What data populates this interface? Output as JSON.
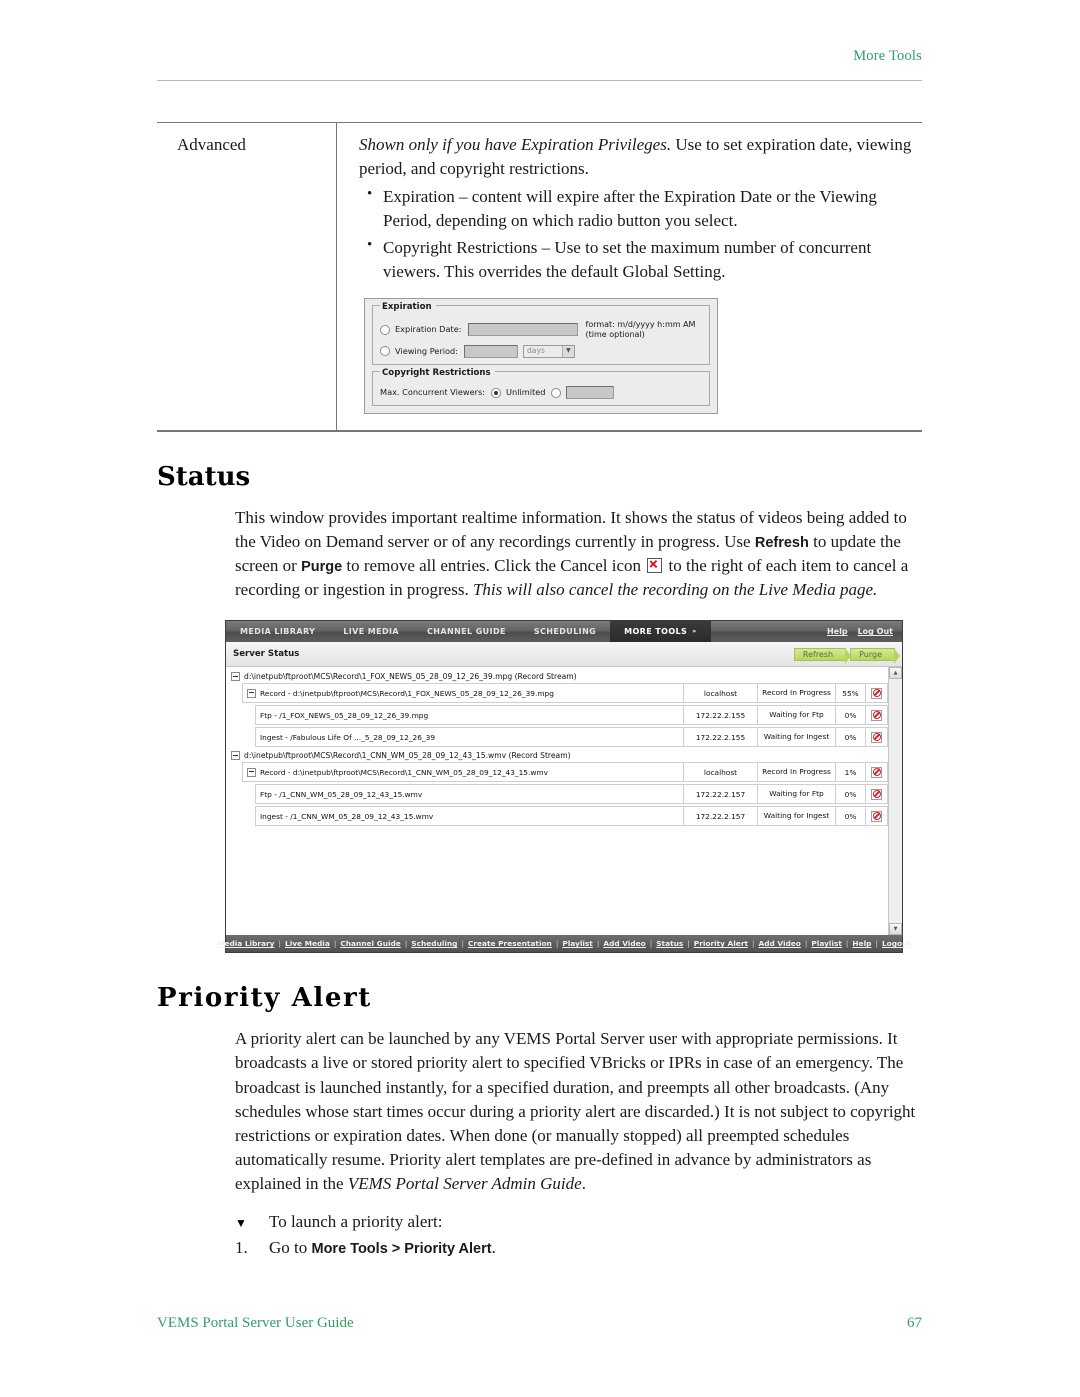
{
  "header": {
    "running_head": "More Tools"
  },
  "footer": {
    "guide_title": "VEMS Portal Server User Guide",
    "page_number": "67"
  },
  "definition_table": {
    "term": "Advanced",
    "intro_italic": "Shown only if you have Expiration Privileges.",
    "intro_rest": " Use to set expiration date, viewing period, and copyright restrictions.",
    "bullets": [
      "Expiration – content will expire after the Expiration Date or the Viewing Period, depending on which radio button you select.",
      "Copyright Restrictions – Use to set the maximum number of concurrent viewers. This overrides the default Global Setting."
    ]
  },
  "expiration_form": {
    "expiration_legend": "Expiration",
    "expiration_date_label": "Expiration Date:",
    "expiration_date_value": "",
    "format_hint": "format: m/d/yyyy h:mm AM\n(time optional)",
    "viewing_period_label": "Viewing Period:",
    "viewing_period_value": "",
    "viewing_period_unit": "days",
    "copyright_legend": "Copyright Restrictions",
    "max_viewers_label": "Max. Concurrent Viewers:",
    "unlimited_label": "Unlimited",
    "max_viewers_value": ""
  },
  "status_section": {
    "heading": "Status",
    "para_1": "This window provides important realtime information. It shows the status of videos being added to the Video on Demand server or of any recordings currently in progress. Use ",
    "bold_refresh": "Refresh",
    "para_2": " to update the screen or ",
    "bold_purge": "Purge",
    "para_3": " to remove all entries. Click the Cancel icon ",
    "para_4": " to the right of each item to cancel a recording or ingestion in progress. ",
    "para_italic": "This will also cancel the recording on the Live Media page."
  },
  "server_status_shot": {
    "nav_tabs": [
      {
        "label": "MEDIA LIBRARY",
        "active": false
      },
      {
        "label": "LIVE MEDIA",
        "active": false
      },
      {
        "label": "CHANNEL GUIDE",
        "active": false
      },
      {
        "label": "SCHEDULING",
        "active": false
      },
      {
        "label": "MORE TOOLS",
        "active": true,
        "caret": "»"
      }
    ],
    "nav_right": [
      "Help",
      "Log Out"
    ],
    "panel_title": "Server Status",
    "buttons": {
      "refresh": "Refresh",
      "purge": "Purge"
    },
    "groups": [
      {
        "header": "d:\\inetpub\\ftproot\\MCS\\Record\\1_FOX_NEWS_05_28_09_12_26_39.mpg (Record Stream)",
        "rows": [
          {
            "name": "Record - d:\\inetpub\\ftproot\\MCS\\Record\\1_FOX_NEWS_05_28_09_12_26_39.mpg",
            "host": "localhost",
            "state": "Record In Progress",
            "percent": "55%",
            "indent": 1,
            "expander": true
          },
          {
            "name": "Ftp - /1_FOX_NEWS_05_28_09_12_26_39.mpg",
            "host": "172.22.2.155",
            "state": "Waiting for Ftp",
            "percent": "0%",
            "indent": 2,
            "expander": false
          },
          {
            "name": "Ingest - /Fabulous Life Of ..._5_28_09_12_26_39",
            "host": "172.22.2.155",
            "state": "Waiting for Ingest",
            "percent": "0%",
            "indent": 2,
            "expander": false
          }
        ]
      },
      {
        "header": "d:\\inetpub\\ftproot\\MCS\\Record\\1_CNN_WM_05_28_09_12_43_15.wmv (Record Stream)",
        "rows": [
          {
            "name": "Record - d:\\inetpub\\ftproot\\MCS\\Record\\1_CNN_WM_05_28_09_12_43_15.wmv",
            "host": "localhost",
            "state": "Record In Progress",
            "percent": "1%",
            "indent": 1,
            "expander": true
          },
          {
            "name": "Ftp - /1_CNN_WM_05_28_09_12_43_15.wmv",
            "host": "172.22.2.157",
            "state": "Waiting for Ftp",
            "percent": "0%",
            "indent": 2,
            "expander": false
          },
          {
            "name": "Ingest - /1_CNN_WM_05_28_09_12_43_15.wmv",
            "host": "172.22.2.157",
            "state": "Waiting for Ingest",
            "percent": "0%",
            "indent": 2,
            "expander": false
          }
        ]
      }
    ],
    "footer_links": [
      "Media Library",
      "Live Media",
      "Channel Guide",
      "Scheduling",
      "Create Presentation",
      "Playlist",
      "Add Video",
      "Status",
      "Priority Alert",
      "Add Video",
      "Playlist",
      "Help",
      "Logout"
    ]
  },
  "priority_alert_section": {
    "heading": "Priority Alert",
    "para_1": "A priority alert can be launched by any VEMS Portal Server user with appropriate permissions. It broadcasts a live or stored priority alert to specified VBricks or IPRs in case of an emergency. The broadcast is launched instantly, for a specified duration, and preempts all other broadcasts. (Any schedules whose start times occur during a priority alert are discarded.) It is not subject to copyright restrictions or expiration dates. When done (or manually stopped) all preempted schedules automatically resume. Priority alert templates are pre-defined in advance by administrators as explained in the ",
    "para_italic": "VEMS Portal Server Admin Guide",
    "para_end": ".",
    "procedure_marker": "▼",
    "procedure_title": "To launch a priority alert:",
    "step_number": "1.",
    "step_text_before": "Go to ",
    "step_text_bold": "More Tools > Priority Alert",
    "step_text_after": "."
  },
  "colors": {
    "accent_green": "#2f9e68",
    "cancel_red": "#d3232a",
    "button_green": "#b9d35f"
  }
}
